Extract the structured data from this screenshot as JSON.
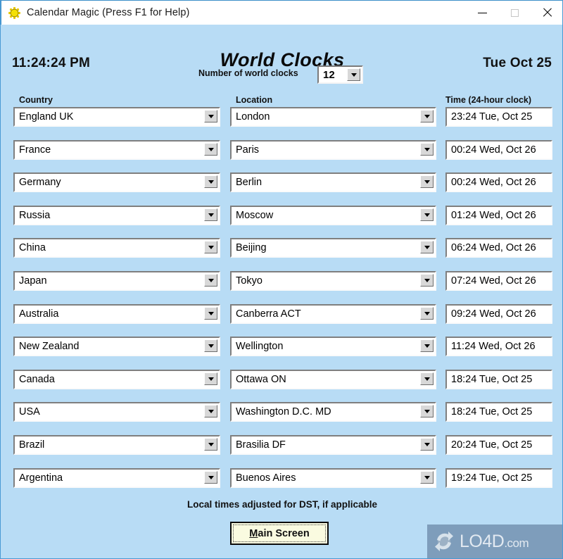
{
  "window": {
    "title": "Calendar Magic (Press F1 for Help)",
    "icon": "sun-icon",
    "controls": {
      "minimize": "minimize-icon",
      "maximize": "maximize-icon",
      "close": "close-icon"
    }
  },
  "header": {
    "local_time": "11:24:24 PM",
    "screen_title": "World Clocks",
    "today_date": "Tue Oct 25"
  },
  "clock_count": {
    "label": "Number of world clocks",
    "value": "12"
  },
  "columns": {
    "country": "Country",
    "location": "Location",
    "time": "Time (24-hour clock)"
  },
  "rows": [
    {
      "country": "England UK",
      "location": "London",
      "time": "23:24 Tue, Oct 25"
    },
    {
      "country": "France",
      "location": "Paris",
      "time": "00:24 Wed, Oct 26"
    },
    {
      "country": "Germany",
      "location": "Berlin",
      "time": "00:24 Wed, Oct 26"
    },
    {
      "country": "Russia",
      "location": "Moscow",
      "time": "01:24 Wed, Oct 26"
    },
    {
      "country": "China",
      "location": "Beijing",
      "time": "06:24 Wed, Oct 26"
    },
    {
      "country": "Japan",
      "location": "Tokyo",
      "time": "07:24 Wed, Oct 26"
    },
    {
      "country": "Australia",
      "location": "Canberra ACT",
      "time": "09:24 Wed, Oct 26"
    },
    {
      "country": "New Zealand",
      "location": "Wellington",
      "time": "11:24 Wed, Oct 26"
    },
    {
      "country": "Canada",
      "location": "Ottawa ON",
      "time": "18:24 Tue, Oct 25"
    },
    {
      "country": "USA",
      "location": "Washington D.C. MD",
      "time": "18:24 Tue, Oct 25"
    },
    {
      "country": "Brazil",
      "location": "Brasilia DF",
      "time": "20:24 Tue, Oct 25"
    },
    {
      "country": "Argentina",
      "location": "Buenos Aires",
      "time": "19:24 Tue, Oct 25"
    }
  ],
  "footer": {
    "dst_note": "Local times adjusted for DST, if applicable",
    "main_button_accel": "M",
    "main_button_rest": "ain Screen"
  },
  "watermark": {
    "text": "LO4D",
    "suffix": ".com"
  },
  "colors": {
    "background": "#b8dcf5",
    "titlebar": "#ffffff",
    "field": "#ffffff",
    "button": "#fafbe0",
    "text": "#111111",
    "icon_yellow": "#f4e006"
  }
}
